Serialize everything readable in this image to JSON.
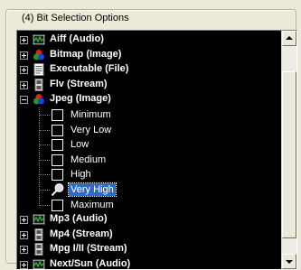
{
  "group": {
    "title": "(4)  Bit Selection Options"
  },
  "tree": {
    "items_before": [
      {
        "label": "Aiff (Audio)",
        "icon": "audio-wave-icon"
      },
      {
        "label": "Bitmap (Image)",
        "icon": "image-color-icon"
      },
      {
        "label": "Executable (File)",
        "icon": "executable-file-icon"
      },
      {
        "label": "Flv (Stream)",
        "icon": "stream-film-icon"
      }
    ],
    "expanded": {
      "label": "Jpeg (Image)",
      "icon": "image-color-icon"
    },
    "children": [
      {
        "label": "Minimum"
      },
      {
        "label": "Very Low"
      },
      {
        "label": "Low"
      },
      {
        "label": "Medium"
      },
      {
        "label": "High"
      },
      {
        "label": "Very High",
        "selected": true
      },
      {
        "label": "Maximum"
      }
    ],
    "items_after": [
      {
        "label": "Mp3 (Audio)",
        "icon": "audio-wave-icon"
      },
      {
        "label": "Mp4 (Stream)",
        "icon": "stream-film-icon"
      },
      {
        "label": "Mpg I/II (Stream)",
        "icon": "stream-film-icon"
      },
      {
        "label": "Next/Sun (Audio)",
        "icon": "audio-wave-icon"
      }
    ]
  },
  "colors": {
    "tree_bg": "#000000",
    "selection": "#316ac5",
    "window_bg": "#ece9d8"
  }
}
